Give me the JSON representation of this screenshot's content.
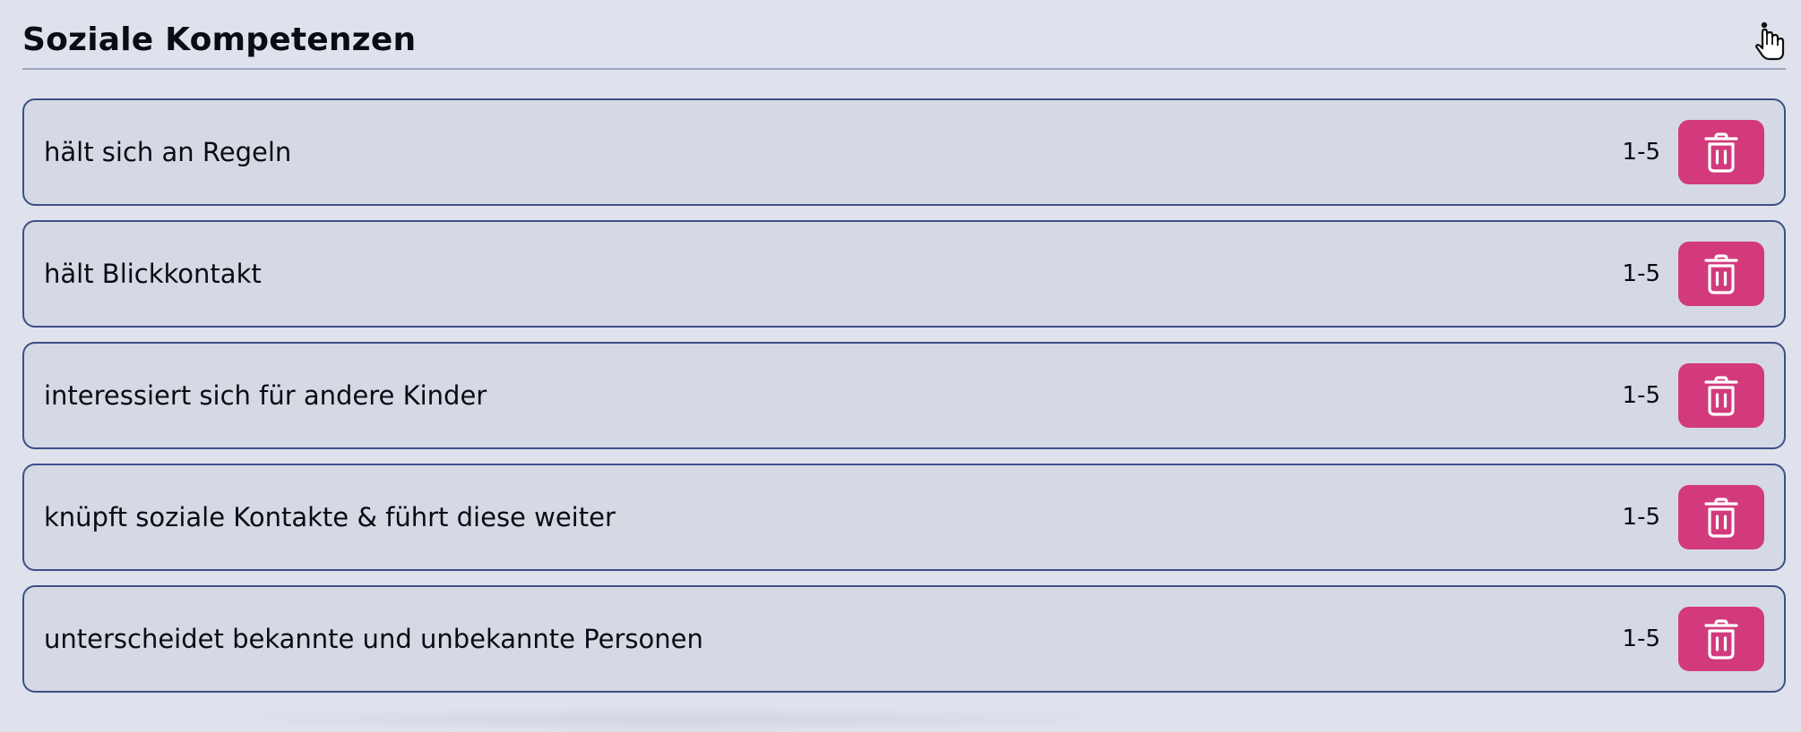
{
  "section": {
    "title": "Soziale Kompetenzen"
  },
  "items": [
    {
      "label": "hält sich an Regeln",
      "range": "1-5",
      "delete_icon": "trash-icon"
    },
    {
      "label": "hält Blickkontakt",
      "range": "1-5",
      "delete_icon": "trash-icon"
    },
    {
      "label": "interessiert sich für andere Kinder",
      "range": "1-5",
      "delete_icon": "trash-icon"
    },
    {
      "label": "knüpft soziale Kontakte & führt diese weiter",
      "range": "1-5",
      "delete_icon": "trash-icon"
    },
    {
      "label": "unterscheidet bekannte und unbekannte Personen",
      "range": "1-5",
      "delete_icon": "trash-icon"
    }
  ],
  "colors": {
    "background": "#dfe2ec",
    "card_border": "#3d4f8a",
    "delete_button": "#d23a7c"
  },
  "cursor": "hand-pointer-icon"
}
